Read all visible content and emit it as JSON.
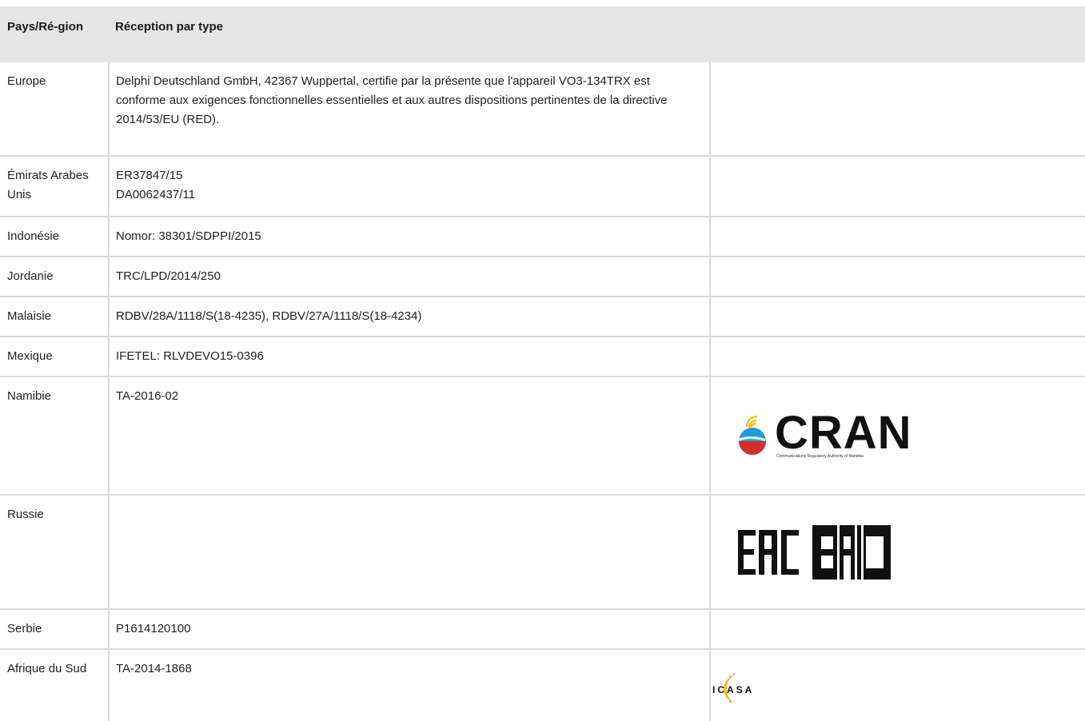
{
  "header": {
    "col_country": "Pays/Ré-gion",
    "col_reception": "Réception par type"
  },
  "rows": [
    {
      "country": "Europe",
      "reception": "Delphi Deutschland GmbH, 42367 Wuppertal, certifie par la présente que l'appareil VO3-134TRX est conforme aux exigences fonctionnelles essentielles et aux autres dispositions pertinentes de la directive 2014/53/EU (RED)."
    },
    {
      "country": "Émirats Arabes Unis",
      "reception_line1": "ER37847/15",
      "reception_line2": "DA0062437/11"
    },
    {
      "country": "Indonésie",
      "reception": "Nomor: 38301/SDPPI/2015"
    },
    {
      "country": "Jordanie",
      "reception": "TRC/LPD/2014/250"
    },
    {
      "country": "Malaisie",
      "reception": "RDBV/28A/1118/S(18-4235), RDBV/27A/1118/S(18-4234)"
    },
    {
      "country": "Mexique",
      "reception": "IFETEL: RLVDEVO15-0396"
    },
    {
      "country": "Namibie",
      "reception": "TA-2016-02",
      "logo": "cran-logo",
      "logo_text": "CRAN",
      "logo_subtext": "Communications Regulatory Authority of Namibia"
    },
    {
      "country": "Russie",
      "reception": "",
      "logo": "eac-logo",
      "logo_text": "EAC"
    },
    {
      "country": "Serbie",
      "reception": "P1614120100"
    },
    {
      "country": "Afrique du Sud",
      "reception": "TA-2014-1868",
      "logo": "icasa-logo",
      "logo_text": "ICASA"
    }
  ],
  "colors": {
    "header_bg": "#e6e6e6",
    "border": "#dcdcdc",
    "text": "#222222"
  }
}
